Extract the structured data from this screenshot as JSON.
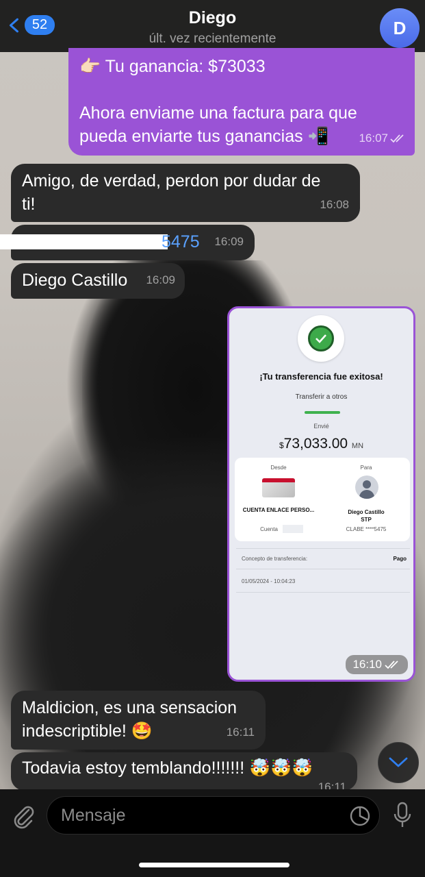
{
  "header": {
    "back_count": "52",
    "title": "Diego",
    "subtitle": "últ. vez recientemente",
    "avatar_letter": "D"
  },
  "messages": [
    {
      "id": "m1",
      "direction": "outgoing",
      "lines": [
        "👉🏻 Tu ganancia: $73033",
        "",
        "Ahora enviame una factura para que",
        "pueda enviarte tus ganancias 📲"
      ],
      "time": "16:07",
      "read": true
    },
    {
      "id": "m2",
      "direction": "incoming",
      "lines": [
        "Amigo, de verdad, perdon por dudar de",
        "ti!"
      ],
      "time": "16:08"
    },
    {
      "id": "m3",
      "direction": "incoming",
      "text": "5475",
      "time": "16:09"
    },
    {
      "id": "m4",
      "direction": "incoming",
      "text": "Diego Castillo",
      "time": "16:09"
    },
    {
      "id": "m5",
      "direction": "outgoing",
      "type": "image",
      "time": "16:10",
      "read": true
    },
    {
      "id": "m6",
      "direction": "incoming",
      "lines": [
        "Maldicion, es una sensacion",
        "indescriptible! 🤩"
      ],
      "time": "16:11"
    },
    {
      "id": "m7",
      "direction": "incoming",
      "text": "Todavia estoy temblando!!!!!!! 🤯🤯🤯",
      "time": "16:11"
    }
  ],
  "receipt": {
    "title": "¡Tu transferencia fue exitosa!",
    "subtitle": "Transferir a otros",
    "sent_label": "Envié",
    "currency_symbol": "$",
    "amount": "73,033.00",
    "currency": "MN",
    "from_label": "Desde",
    "from_name": "CUENTA ENLACE PERSO...",
    "from_account": "Cuenta",
    "to_label": "Para",
    "to_name": "Diego Castillo",
    "to_bank": "STP",
    "to_clabe": "CLABE ****5475",
    "concept_label": "Concepto de transferencia:",
    "concept_value": "Pago",
    "date": "01/05/2024 - 10:04:23"
  },
  "input": {
    "placeholder": "Mensaje"
  },
  "colors": {
    "accent": "#2f7ff0",
    "outgoing_bubble": "#9a53d6",
    "incoming_bubble": "#2a2a2a",
    "success": "#3fb14e"
  },
  "icons": [
    "chevron-left-icon",
    "paperclip-icon",
    "sticker-icon",
    "microphone-icon",
    "chevron-down-icon",
    "double-check-icon",
    "check-icon",
    "user-icon"
  ]
}
